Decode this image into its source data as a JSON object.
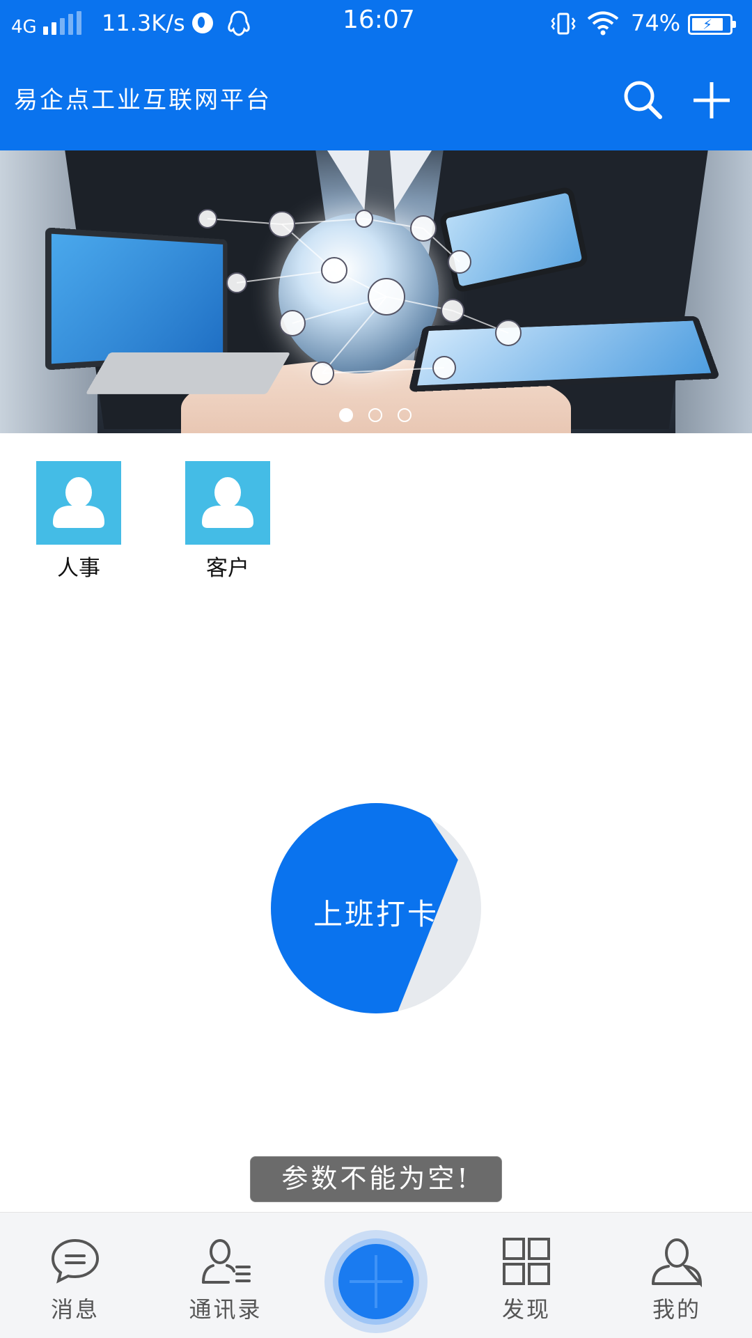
{
  "status_bar": {
    "network": "4G",
    "speed": "11.3K/s",
    "time": "16:07",
    "battery": "74%",
    "battery_level": 0.74,
    "icons": [
      "signal-icon",
      "globe-icon",
      "qq-penguin-icon",
      "vibrate-icon",
      "wifi-icon",
      "battery-charging-icon"
    ]
  },
  "header": {
    "title": "易企点工业互联网平台",
    "icons": [
      "search-icon",
      "plus-icon"
    ]
  },
  "banner": {
    "slide_count": 3,
    "active_slide": 1
  },
  "shortcuts": [
    {
      "label": "人事",
      "icon": "person-icon"
    },
    {
      "label": "客户",
      "icon": "person-icon"
    }
  ],
  "checkin": {
    "label": "上班打卡"
  },
  "toast": {
    "message": "参数不能为空!"
  },
  "bottom_nav": {
    "items": [
      {
        "label": "消息",
        "icon": "message-bubble-icon"
      },
      {
        "label": "通讯录",
        "icon": "contacts-icon"
      },
      {
        "label": "",
        "icon": "plus-icon"
      },
      {
        "label": "发现",
        "icon": "grid-icon"
      },
      {
        "label": "我的",
        "icon": "user-icon"
      }
    ]
  },
  "colors": {
    "primary": "#0a73ee",
    "tile": "#44bce6",
    "nav_bg": "#f4f5f7",
    "toast_bg": "#6b6b6b"
  }
}
